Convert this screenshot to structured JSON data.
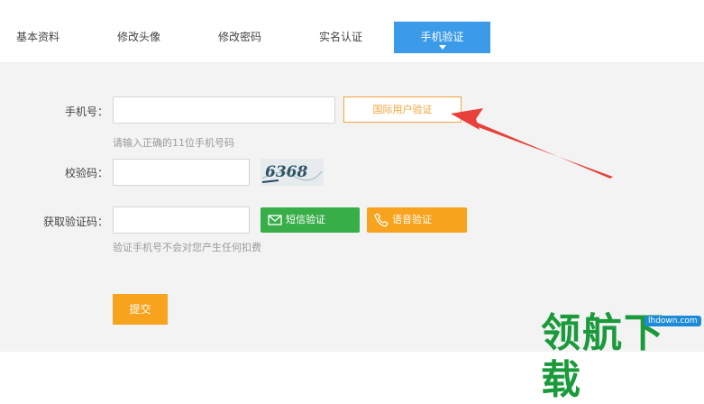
{
  "tabs": [
    {
      "label": "基本资料"
    },
    {
      "label": "修改头像"
    },
    {
      "label": "修改密码"
    },
    {
      "label": "实名认证"
    },
    {
      "label": "手机验证"
    }
  ],
  "form": {
    "phone_label": "手机号：",
    "phone_value": "",
    "phone_hint": "请输入正确的11位手机号码",
    "intl_button": "国际用户验证",
    "check_label": "校验码：",
    "check_value": "",
    "captcha_text": "6368",
    "code_label": "获取验证码：",
    "code_value": "",
    "sms_button": "短信验证",
    "voice_button": "语音验证",
    "code_hint": "验证手机号不会对您产生任何扣费",
    "submit_button": "提交"
  },
  "watermark": {
    "text": "领航下载",
    "url": "lhdown.com"
  },
  "colors": {
    "tab_active": "#3c9be9",
    "orange": "#f7a31d",
    "green": "#37ae48",
    "arrow": "#e8403a"
  }
}
